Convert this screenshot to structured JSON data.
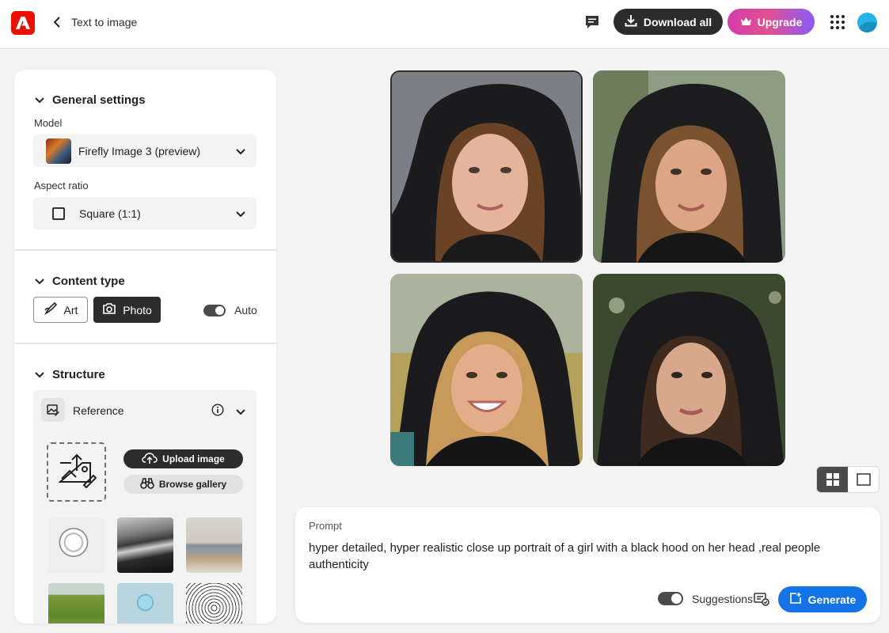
{
  "header": {
    "title": "Text to image",
    "download_all_label": "Download all",
    "upgrade_label": "Upgrade"
  },
  "sidebar": {
    "general_settings": {
      "title": "General settings",
      "model_label": "Model",
      "model_value": "Firefly Image 3 (preview)",
      "aspect_label": "Aspect ratio",
      "aspect_value": "Square (1:1)"
    },
    "content_type": {
      "title": "Content type",
      "art_label": "Art",
      "photo_label": "Photo",
      "selected": "Photo",
      "auto_label": "Auto",
      "auto_on": true
    },
    "structure": {
      "title": "Structure",
      "reference_label": "Reference",
      "upload_label": "Upload image",
      "browse_label": "Browse gallery"
    }
  },
  "gallery": {
    "selected_index": 0,
    "view_mode": "grid"
  },
  "prompt": {
    "label": "Prompt",
    "text": "hyper detailed, hyper realistic close up portrait of a girl with a black hood on her head ,real people authenticity",
    "suggestions_label": "Suggestions",
    "suggestions_on": true,
    "generate_label": "Generate"
  },
  "colors": {
    "accent_blue": "#1473e6",
    "adobe_red": "#eb1000",
    "dark_button": "#2c2c2c"
  },
  "icons": [
    "adobe-logo-icon",
    "chevron-left-icon",
    "feedback-icon",
    "download-icon",
    "crown-icon",
    "apps-grid-icon",
    "avatar-icon",
    "chevron-down-icon",
    "square-icon",
    "brush-icon",
    "camera-icon",
    "reference-image-icon",
    "info-icon",
    "image-upload-icon",
    "cloud-upload-icon",
    "binoculars-icon",
    "grid-view-icon",
    "single-view-icon",
    "generate-icon",
    "suggestions-settings-icon"
  ]
}
